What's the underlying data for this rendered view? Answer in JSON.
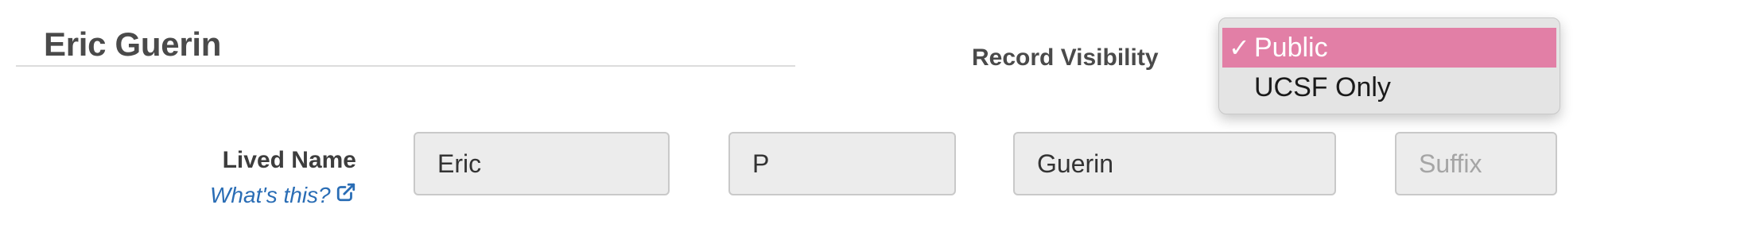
{
  "record": {
    "person_name": "Eric Guerin"
  },
  "visibility": {
    "label": "Record Visibility",
    "options": [
      {
        "label": "Public",
        "check": "✓",
        "selected": true
      },
      {
        "label": "UCSF Only",
        "check": "",
        "selected": false
      }
    ],
    "selected_color": "#e27fa6"
  },
  "lived_name": {
    "label": "Lived Name",
    "help_link": "What's this?",
    "help_icon": "external-link-icon",
    "first": {
      "value": "Eric",
      "placeholder": ""
    },
    "middle": {
      "value": "P",
      "placeholder": ""
    },
    "last": {
      "value": "Guerin",
      "placeholder": ""
    },
    "suffix": {
      "value": "",
      "placeholder": "Suffix"
    }
  }
}
